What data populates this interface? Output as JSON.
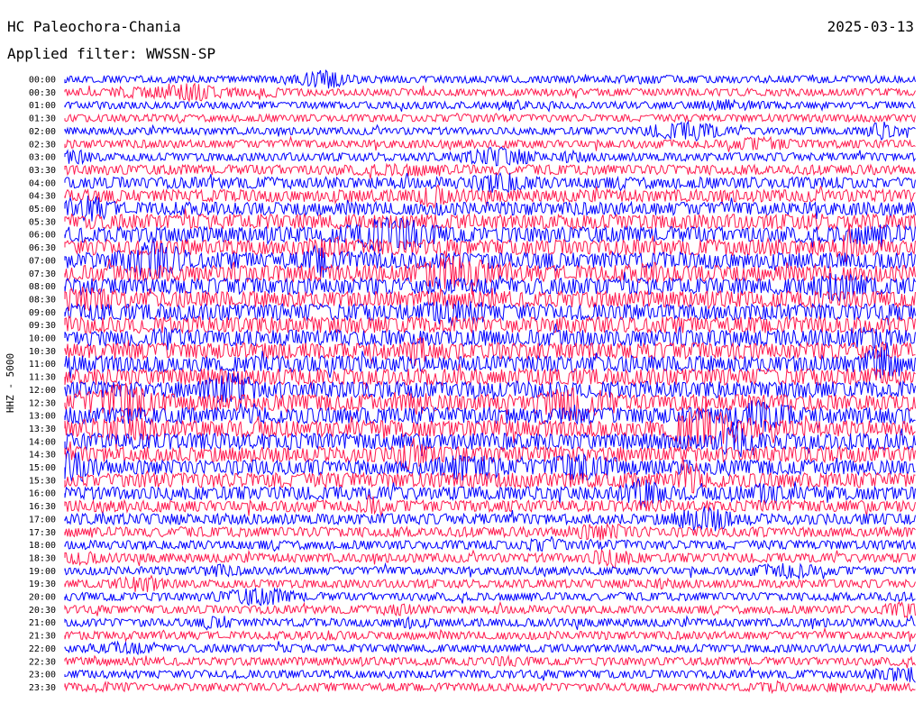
{
  "header": {
    "station": "HC Paleochora-Chania",
    "date": "2025-03-13",
    "filter": "Applied filter: WWSSN-SP"
  },
  "chart_data": {
    "type": "seismogram",
    "channel_label": "HHZ - 5000",
    "colors": [
      "#0000ff",
      "#ff1a4f"
    ],
    "rows": [
      {
        "label": "00:00",
        "amp": 0.45
      },
      {
        "label": "00:30",
        "amp": 0.45
      },
      {
        "label": "01:00",
        "amp": 0.45
      },
      {
        "label": "01:30",
        "amp": 0.45
      },
      {
        "label": "02:00",
        "amp": 0.45
      },
      {
        "label": "02:30",
        "amp": 0.5
      },
      {
        "label": "03:00",
        "amp": 0.5
      },
      {
        "label": "03:30",
        "amp": 0.6
      },
      {
        "label": "04:00",
        "amp": 0.7
      },
      {
        "label": "04:30",
        "amp": 0.75
      },
      {
        "label": "05:00",
        "amp": 0.8
      },
      {
        "label": "05:30",
        "amp": 0.9
      },
      {
        "label": "06:00",
        "amp": 0.95
      },
      {
        "label": "06:30",
        "amp": 0.95
      },
      {
        "label": "07:00",
        "amp": 1.0
      },
      {
        "label": "07:30",
        "amp": 1.0
      },
      {
        "label": "08:00",
        "amp": 1.0
      },
      {
        "label": "08:30",
        "amp": 1.0
      },
      {
        "label": "09:00",
        "amp": 1.0
      },
      {
        "label": "09:30",
        "amp": 1.0
      },
      {
        "label": "10:00",
        "amp": 1.0
      },
      {
        "label": "10:30",
        "amp": 1.0
      },
      {
        "label": "11:00",
        "amp": 1.0
      },
      {
        "label": "11:30",
        "amp": 1.0
      },
      {
        "label": "12:00",
        "amp": 1.0
      },
      {
        "label": "12:30",
        "amp": 1.0
      },
      {
        "label": "13:00",
        "amp": 1.0
      },
      {
        "label": "13:30",
        "amp": 1.0
      },
      {
        "label": "14:00",
        "amp": 1.0
      },
      {
        "label": "14:30",
        "amp": 0.95
      },
      {
        "label": "15:00",
        "amp": 0.9
      },
      {
        "label": "15:30",
        "amp": 0.9
      },
      {
        "label": "16:00",
        "amp": 0.8
      },
      {
        "label": "16:30",
        "amp": 0.7
      },
      {
        "label": "17:00",
        "amp": 0.65
      },
      {
        "label": "17:30",
        "amp": 0.6
      },
      {
        "label": "18:00",
        "amp": 0.55
      },
      {
        "label": "18:30",
        "amp": 0.55
      },
      {
        "label": "19:00",
        "amp": 0.5
      },
      {
        "label": "19:30",
        "amp": 0.5
      },
      {
        "label": "20:00",
        "amp": 0.5
      },
      {
        "label": "20:30",
        "amp": 0.5
      },
      {
        "label": "21:00",
        "amp": 0.5
      },
      {
        "label": "21:30",
        "amp": 0.5
      },
      {
        "label": "22:00",
        "amp": 0.5
      },
      {
        "label": "22:30",
        "amp": 0.5
      },
      {
        "label": "23:00",
        "amp": 0.5
      },
      {
        "label": "23:30",
        "amp": 0.5
      }
    ]
  }
}
